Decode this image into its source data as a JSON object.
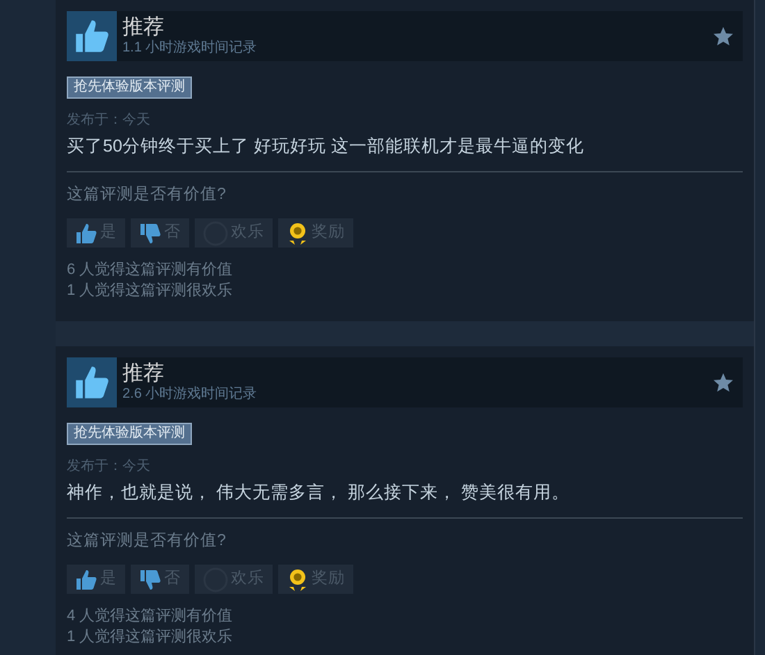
{
  "reviews": [
    {
      "verdict": "推荐",
      "hours": "1.1 小时游戏时间记录",
      "badge": "抢先体验版本评测",
      "posted": "发布于：今天",
      "text": "买了50分钟终于买上了 好玩好玩 这一部能联机才是最牛逼的变化",
      "question": "这篇评测是否有价值?",
      "buttons": [
        {
          "kind": "yes",
          "label": "是"
        },
        {
          "kind": "no",
          "label": "否"
        },
        {
          "kind": "funny",
          "label": "欢乐"
        },
        {
          "kind": "award",
          "label": "奖励"
        }
      ],
      "stats": [
        "6 人觉得这篇评测有价值",
        "1 人觉得这篇评测很欢乐"
      ]
    },
    {
      "verdict": "推荐",
      "hours": "2.6 小时游戏时间记录",
      "badge": "抢先体验版本评测",
      "posted": "发布于：今天",
      "text": "神作，也就是说， 伟大无需多言， 那么接下来， 赞美很有用。",
      "question": "这篇评测是否有价值?",
      "buttons": [
        {
          "kind": "yes",
          "label": "是"
        },
        {
          "kind": "no",
          "label": "否"
        },
        {
          "kind": "funny",
          "label": "欢乐"
        },
        {
          "kind": "award",
          "label": "奖励"
        }
      ],
      "stats": [
        "4 人觉得这篇评测有价值",
        "1 人觉得这篇评测很欢乐"
      ]
    }
  ]
}
